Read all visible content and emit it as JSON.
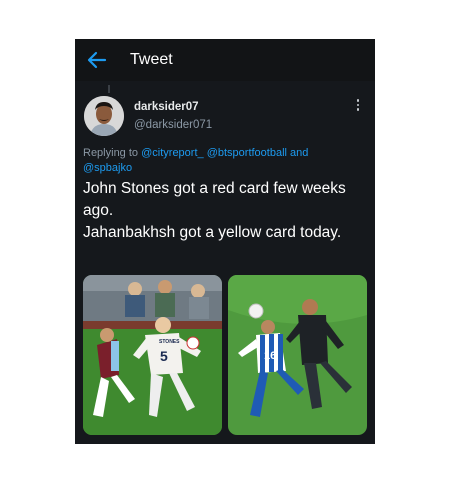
{
  "header": {
    "title": "Tweet",
    "back_icon": "arrow-left-icon"
  },
  "tweet": {
    "author_name": "darksider07",
    "author_handle": "@darksider071",
    "replying_prefix": "Replying to",
    "replying_mentions": [
      "@cityreport_",
      "@btsportfootball"
    ],
    "replying_and": "and",
    "replying_last": "@spbajko",
    "text_lines": [
      "John Stones got a red card few weeks ago.",
      "Jahanbakhsh got a yellow card today."
    ],
    "media_shirt_name": "STONES",
    "media_shirt_number": "5",
    "media_right_shirt_number": "16"
  },
  "colors": {
    "background": "#15181c",
    "accent": "#1d9bf0",
    "text": "#ffffff",
    "muted": "#8b98a5"
  }
}
